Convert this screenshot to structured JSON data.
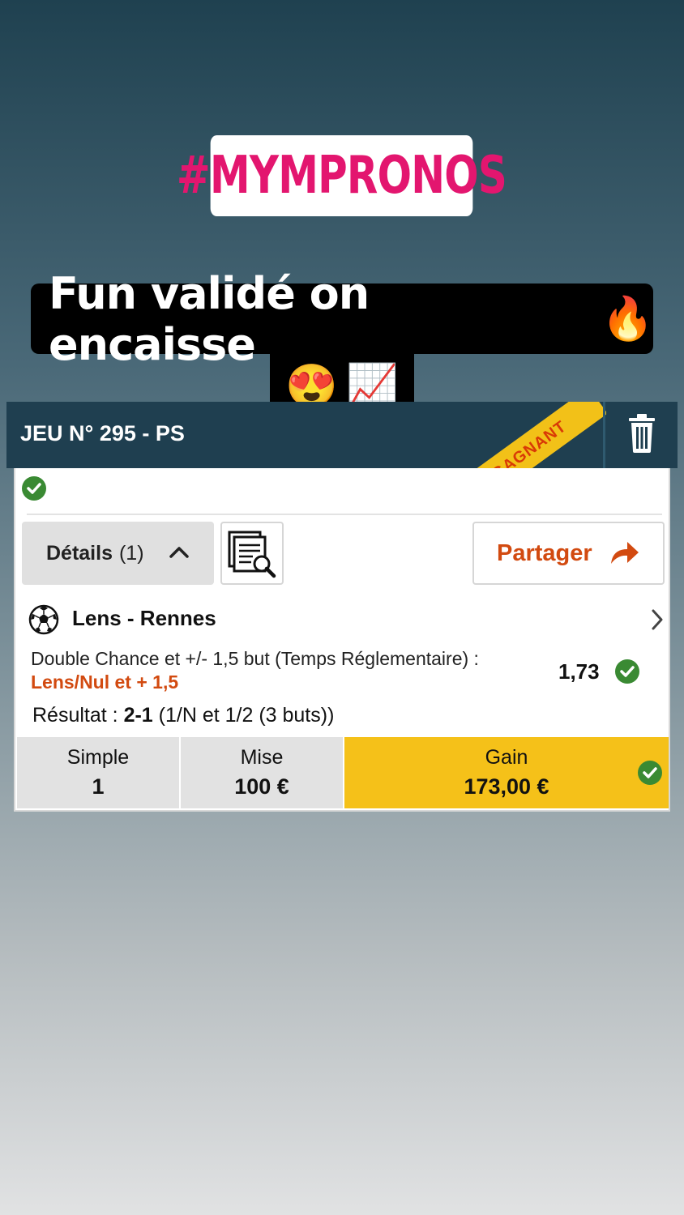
{
  "story": {
    "hashtag": "#MYMPRONOS",
    "caption_line1": "Fun validé on encaisse",
    "caption_emoji_fire": "🔥",
    "caption_emoji_heart_eyes": "😍",
    "caption_emoji_chart": "📈"
  },
  "ticket": {
    "title": "JEU N° 295 - PS",
    "status_ribbon": "GAGNANT",
    "details_label": "Détails",
    "details_count": "(1)",
    "share_label": "Partager",
    "match": "Lens - Rennes",
    "market": "Double Chance et +/- 1,5 but (Temps Réglementaire) :",
    "selection": "Lens/Nul et + 1,5",
    "odds": "1,73",
    "result_label": "Résultat :",
    "result_score": "2-1",
    "result_detail": "(1/N et 1/2 (3 buts))",
    "bet_type_label": "Simple",
    "bet_type_value": "1",
    "stake_label": "Mise",
    "stake_value": "100 €",
    "gain_label": "Gain",
    "gain_value": "173,00 €"
  },
  "colors": {
    "accent_orange": "#d24a10",
    "gain_yellow": "#f5c119",
    "check_green": "#3a8a33",
    "hashtag_pink": "#e3166f",
    "header_navy": "#1f3f50"
  },
  "icons": [
    "trash-icon",
    "check-icon",
    "chevron-up-icon",
    "document-search-icon",
    "share-arrow-icon",
    "soccer-ball-icon",
    "chevron-right-icon"
  ]
}
